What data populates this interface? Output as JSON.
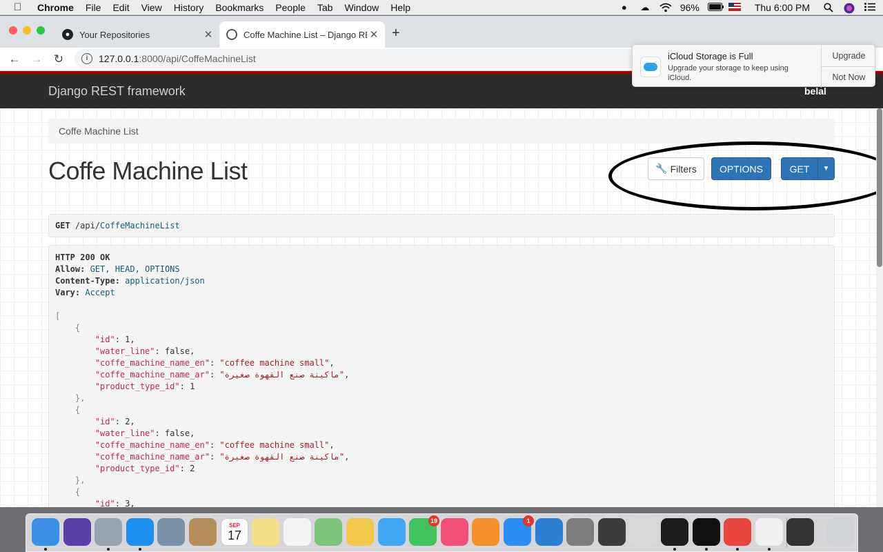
{
  "menubar": {
    "items": [
      "Chrome",
      "File",
      "Edit",
      "View",
      "History",
      "Bookmarks",
      "People",
      "Tab",
      "Window",
      "Help"
    ],
    "battery": "96%",
    "clock": "Thu 6:00 PM"
  },
  "browser": {
    "tabs": [
      {
        "title": "Your Repositories"
      },
      {
        "title": "Coffe Machine List – Django RE"
      }
    ],
    "url_host": "127.0.0.1",
    "url_rest": ":8000/api/CoffeMachineList"
  },
  "notification": {
    "title": "iCloud Storage is Full",
    "message": "Upgrade your storage to keep using iCloud.",
    "action_primary": "Upgrade",
    "action_secondary": "Not Now"
  },
  "drf": {
    "brand": "Django REST framework",
    "user": "belal",
    "breadcrumb": "Coffe Machine List",
    "title": "Coffe Machine List",
    "buttons": {
      "filters": "Filters",
      "options": "OPTIONS",
      "get": "GET"
    },
    "request": {
      "method": "GET",
      "path_prefix": "/api/",
      "path_name": "CoffeMachineList"
    },
    "response": {
      "status": "HTTP 200 OK",
      "headers": [
        {
          "name": "Allow",
          "value": "GET, HEAD, OPTIONS"
        },
        {
          "name": "Content-Type",
          "value": "application/json"
        },
        {
          "name": "Vary",
          "value": "Accept"
        }
      ],
      "items": [
        {
          "id": "1",
          "water_line": "false",
          "name_en": "\"coffee machine small\"",
          "name_ar": "\"ماكينة صنع القهوة صغيرة\"",
          "product_type_id": "1"
        },
        {
          "id": "2",
          "water_line": "false",
          "name_en": "\"coffee machine small\"",
          "name_ar": "\"ماكينة صنع القهوة صغيرة\"",
          "product_type_id": "2"
        },
        {
          "id": "3",
          "water_line": "true"
        }
      ]
    }
  },
  "dock": {
    "apps": [
      {
        "name": "Finder",
        "color": "#3b8fe6"
      },
      {
        "name": "Siri",
        "color": "#5b3fa8"
      },
      {
        "name": "Launchpad",
        "color": "#9aa4b0"
      },
      {
        "name": "Safari",
        "color": "#1d8ff0"
      },
      {
        "name": "Preview",
        "color": "#7a8fa8"
      },
      {
        "name": "Contacts",
        "color": "#b58d5b"
      },
      {
        "name": "Calendar",
        "color": "#ffffff"
      },
      {
        "name": "Notes",
        "color": "#f5e08a"
      },
      {
        "name": "Reminders",
        "color": "#f4f4f4"
      },
      {
        "name": "Maps",
        "color": "#7cc47a"
      },
      {
        "name": "Photos",
        "color": "#f2c84b"
      },
      {
        "name": "Messages",
        "color": "#3fa7f5"
      },
      {
        "name": "FaceTime",
        "color": "#3fc35c"
      },
      {
        "name": "iTunes",
        "color": "#f24e7a"
      },
      {
        "name": "Books",
        "color": "#f5902a"
      },
      {
        "name": "App Store",
        "color": "#2b8ef2"
      },
      {
        "name": "Xcode",
        "color": "#2d7fd6"
      },
      {
        "name": "System Preferences",
        "color": "#7d7d7d"
      },
      {
        "name": "Sublime Text",
        "color": "#3c3c3c"
      },
      {
        "name": "Help",
        "color": "#d9d9d9"
      },
      {
        "name": "PyCharm",
        "color": "#1c1c1c"
      },
      {
        "name": "Terminal",
        "color": "#111111"
      },
      {
        "name": "Chrome",
        "color": "#e8453c"
      },
      {
        "name": "TextEdit",
        "color": "#efefef"
      },
      {
        "name": "Screen",
        "color": "#333333"
      },
      {
        "name": "Trash",
        "color": "#cfd3d6"
      }
    ],
    "calendar_month": "SEP",
    "calendar_day": "17",
    "facetime_badge": "19",
    "appstore_badge": "1"
  }
}
